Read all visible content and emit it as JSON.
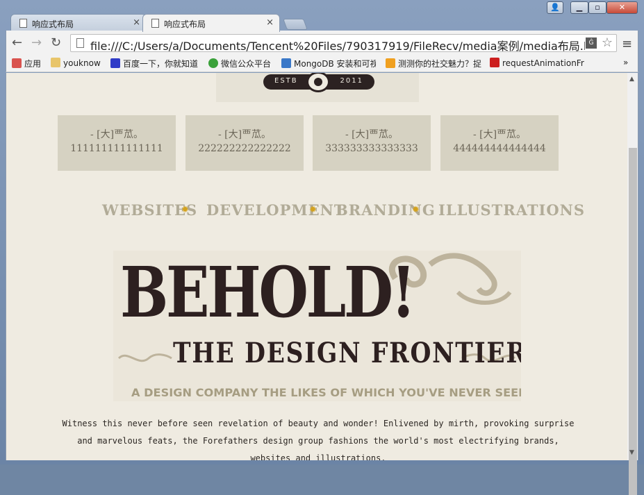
{
  "tabs": [
    {
      "title": "响应式布局",
      "close": "×"
    },
    {
      "title": "响应式布局",
      "close": "×"
    }
  ],
  "address_bar": {
    "url": "file:///C:/Users/a/Documents/Tencent%20Files/790317919/FileRecv/media案例/media布局.htm",
    "translate_icon": "Ĝ"
  },
  "nav_glyphs": {
    "back": "←",
    "forward": "→",
    "reload": "↻",
    "star": "☆",
    "menu": "≡"
  },
  "bookmarks": [
    {
      "label": "应用",
      "icon": "apps-icon",
      "color": "#d9534f"
    },
    {
      "label": "youknow",
      "icon": "folder-icon",
      "color": "#e8c56a"
    },
    {
      "label": "百度一下，你就知道",
      "icon": "baidu-icon",
      "color": "#2f3bc7"
    },
    {
      "label": "微信公众平台",
      "icon": "wechat-icon",
      "color": "#3aa13a"
    },
    {
      "label": "MongoDB 安装和可视",
      "icon": "mongodb-icon",
      "color": "#3a78c8"
    },
    {
      "label": "测测你的社交魅力？捉",
      "icon": "m-icon",
      "color": "#f0a020"
    },
    {
      "label": "requestAnimationFr",
      "icon": "bowtie-icon",
      "color": "#cc1f1f"
    }
  ],
  "bookmarks_overflow": "»",
  "logo": {
    "estb_left": "ESTB",
    "estb_right": "2011"
  },
  "boxes": [
    {
      "line1": "- [大]覀苽。",
      "line2": "111111111111111"
    },
    {
      "line1": "- [大]覀苽。",
      "line2": "222222222222222"
    },
    {
      "line1": "- [大]覀苽。",
      "line2": "333333333333333"
    },
    {
      "line1": "- [大]覀苽。",
      "line2": "444444444444444"
    }
  ],
  "menu_items": [
    "WEBSITES",
    "DEVELOPMENT",
    "BRANDING",
    "ILLUSTRATIONS"
  ],
  "hero": {
    "headline": "BEHOLD!",
    "subheadline": "THE DESIGN FRONTIER",
    "tagline": "A DESIGN COMPANY THE LIKES OF WHICH YOU'VE NEVER SEEN"
  },
  "description": "Witness this never before seen revelation of beauty and wonder! Enlivened by mirth, provoking surprise and marvelous feats, the Forefathers design group fashions the world's most electrifying brands, websites and illustrations.",
  "window_controls": {
    "user": "👤",
    "min": "▁",
    "max": "▫",
    "close": "✕"
  }
}
